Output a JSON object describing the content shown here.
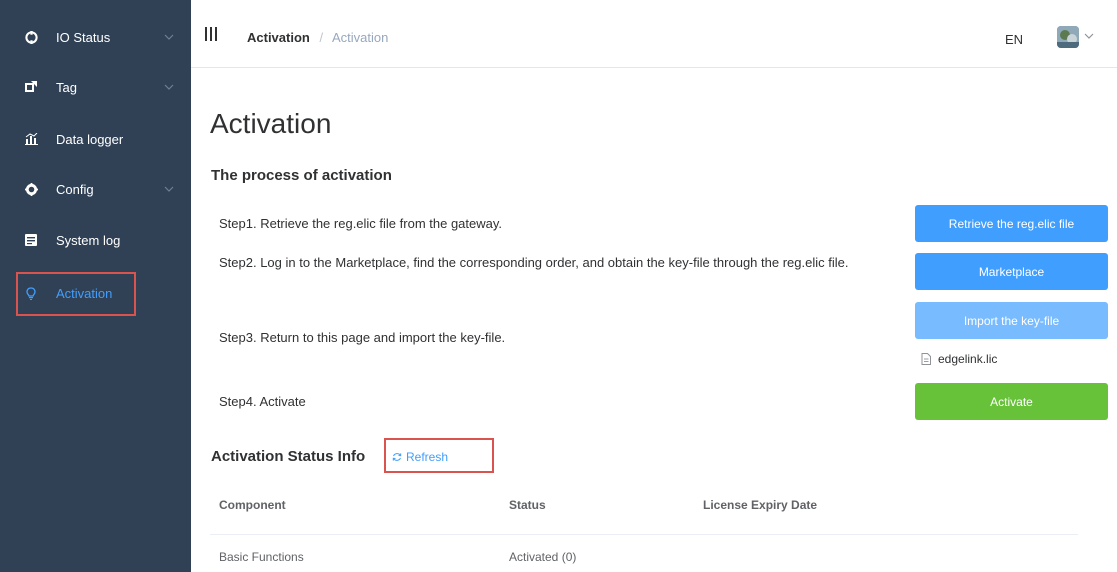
{
  "sidebar": {
    "items": [
      {
        "label": "IO Status",
        "icon": "io-status-icon"
      },
      {
        "label": "Tag",
        "icon": "tag-icon"
      },
      {
        "label": "Data logger",
        "icon": "data-logger-icon"
      },
      {
        "label": "Config",
        "icon": "gear-icon"
      },
      {
        "label": "System log",
        "icon": "system-log-icon"
      },
      {
        "label": "Activation",
        "icon": "activation-icon"
      }
    ]
  },
  "header": {
    "breadcrumb": [
      "Activation",
      "Activation"
    ],
    "separator": "/",
    "language": "EN"
  },
  "main": {
    "title": "Activation",
    "process_title": "The process of activation",
    "steps": [
      {
        "text": "Step1. Retrieve the reg.elic file from the gateway.",
        "button": "Retrieve the reg.elic file"
      },
      {
        "text": "Step2. Log in to the Marketplace, find the corresponding order, and obtain the key-file through the reg.elic file.",
        "button": "Marketplace"
      },
      {
        "text": "Step3. Return to this page and import the key-file.",
        "button": "Import the key-file"
      },
      {
        "text": "Step4. Activate",
        "button": "Activate"
      }
    ],
    "imported_file": "edgelink.lic",
    "status_title": "Activation Status Info",
    "refresh_label": "Refresh",
    "table": {
      "headers": [
        "Component",
        "Status",
        "License Expiry Date"
      ],
      "rows": [
        [
          "Basic Functions",
          "Activated (0)",
          ""
        ]
      ]
    }
  },
  "colors": {
    "sidebar_bg": "#304156",
    "accent": "#409eff",
    "accent_light": "#79bbff",
    "success": "#67c23a",
    "highlight": "#d9534f"
  }
}
